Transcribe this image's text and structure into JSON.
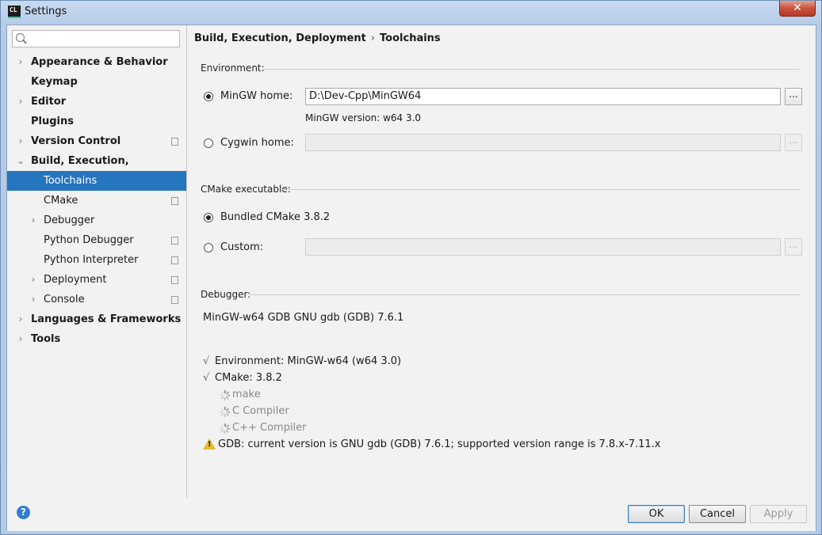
{
  "window": {
    "title": "Settings",
    "app_icon_text": "CL",
    "close_glyph": "✕"
  },
  "search": {
    "placeholder": "",
    "value": ""
  },
  "sidebar": {
    "items": [
      {
        "label": "Appearance & Behavior",
        "level": 0,
        "chevron": "›"
      },
      {
        "label": "Keymap",
        "level": 0
      },
      {
        "label": "Editor",
        "level": 0,
        "chevron": "›"
      },
      {
        "label": "Plugins",
        "level": 0
      },
      {
        "label": "Version Control",
        "level": 0,
        "chevron": "›",
        "project_icon": true
      },
      {
        "label": "Build, Execution, Deployment",
        "level": 0,
        "chevron": "⌄"
      },
      {
        "label": "Toolchains",
        "level": 1,
        "selected": true
      },
      {
        "label": "CMake",
        "level": 1,
        "project_icon": true
      },
      {
        "label": "Debugger",
        "level": 1,
        "chevron": "›"
      },
      {
        "label": "Python Debugger",
        "level": 1,
        "project_icon": true
      },
      {
        "label": "Python Interpreter",
        "level": 1,
        "project_icon": true
      },
      {
        "label": "Deployment",
        "level": 1,
        "chevron": "›",
        "project_icon": true
      },
      {
        "label": "Console",
        "level": 1,
        "chevron": "›",
        "project_icon": true
      },
      {
        "label": "Languages & Frameworks",
        "level": 0,
        "chevron": "›"
      },
      {
        "label": "Tools",
        "level": 0,
        "chevron": "›"
      }
    ]
  },
  "breadcrumb": {
    "parent": "Build, Execution, Deployment",
    "separator": "›",
    "current": "Toolchains"
  },
  "environment": {
    "section_title": "Environment:",
    "mingw_label": "MinGW home:",
    "mingw_value": "D:\\Dev-Cpp\\MinGW64",
    "mingw_version": "MinGW version: w64 3.0",
    "cygwin_label": "Cygwin home:",
    "cygwin_value": "",
    "browse_label": "...",
    "selected": "mingw"
  },
  "cmake": {
    "section_title": "CMake executable:",
    "bundled_label": "Bundled CMake 3.8.2",
    "custom_label": "Custom:",
    "custom_value": "",
    "browse_label": "...",
    "selected": "bundled"
  },
  "debugger": {
    "section_title": "Debugger:",
    "value": "MinGW-w64 GDB GNU gdb (GDB) 7.6.1"
  },
  "status": {
    "check_glyph": "√",
    "environment": "Environment: MinGW-w64 (w64 3.0)",
    "cmake": "CMake: 3.8.2",
    "make": "make",
    "c_compiler": "C Compiler",
    "cpp_compiler": "C++ Compiler",
    "gdb_warning": "GDB: current version is GNU gdb (GDB) 7.6.1; supported version range is 7.8.x-7.11.x"
  },
  "footer": {
    "help_glyph": "?",
    "ok": "OK",
    "cancel": "Cancel",
    "apply": "Apply"
  },
  "colors": {
    "selection": "#2675bf",
    "warning": "#e8b82c",
    "help": "#2f7dd1"
  }
}
